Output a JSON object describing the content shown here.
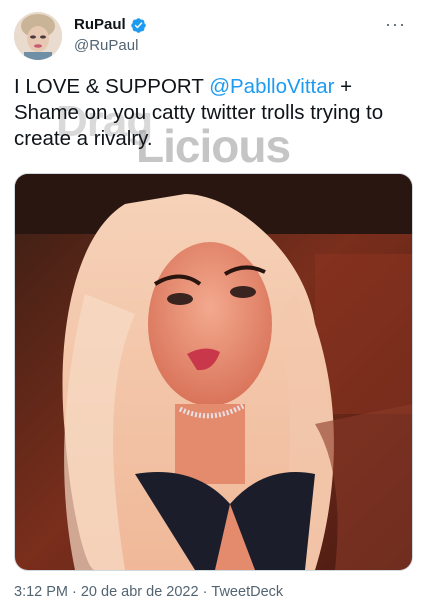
{
  "user": {
    "display_name": "RuPaul",
    "handle": "@RuPaul",
    "verified_icon": "verified-badge-icon"
  },
  "tweet": {
    "line1_prefix": "I LOVE & SUPPORT ",
    "mention": "@PablloVittar",
    "line1_suffix": " +",
    "rest": "Shame on you catty twitter trolls trying to create a rivalry."
  },
  "watermark": {
    "logo_text": "DragLicious"
  },
  "meta": {
    "time": "3:12 PM",
    "date": "20 de abr de 2022",
    "source": "TweetDeck",
    "separator": "·"
  },
  "colors": {
    "link": "#1d9bf0",
    "muted": "#536471",
    "verified": "#1d9bf0"
  },
  "menu": {
    "more_icon": "more-horizontal-icon"
  }
}
